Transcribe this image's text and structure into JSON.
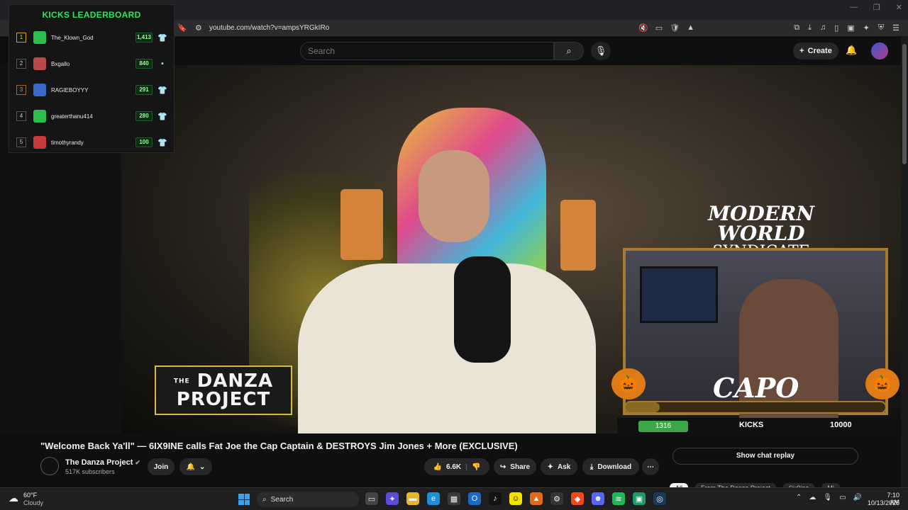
{
  "browser": {
    "url": "youtube.com/watch?v=ampsYRGkIRo"
  },
  "yt_header": {
    "search_placeholder": "Search",
    "create_label": "Create"
  },
  "leaderboard": {
    "title": "KICKS LEADERBOARD",
    "rows": [
      {
        "rank": "1",
        "name": "The_Klown_God",
        "score": "1,413",
        "avatar_color": "#2dbd4e"
      },
      {
        "rank": "2",
        "name": "Bxgallo",
        "score": "840",
        "avatar_color": "#b84a4a"
      },
      {
        "rank": "3",
        "name": "RAGIEBOYYY",
        "score": "291",
        "avatar_color": "#3a6ac9"
      },
      {
        "rank": "4",
        "name": "greaterthanu414",
        "score": "280",
        "avatar_color": "#2dbd4e"
      },
      {
        "rank": "5",
        "name": "timothyrandy",
        "score": "100",
        "avatar_color": "#c93a3a"
      }
    ]
  },
  "overlay": {
    "logo_line1": "DANZA",
    "logo_line2": "PROJECT",
    "logo_prefix": "THE",
    "mws_line1": "MODERN WORLD",
    "mws_line2": "SYNDICATE",
    "capo": "CAPO",
    "kicks_current": "1316",
    "kicks_label": "KICKS",
    "kicks_goal": "10000",
    "progress_fraction": 0.13
  },
  "video": {
    "title": "\"Welcome Back Ya'll\" — 6IX9INE calls Fat Joe the Cap Captain & DESTROYS Jim Jones + More (EXCLUSIVE)",
    "channel": "The Danza Project",
    "subscribers": "517K subscribers",
    "join_label": "Join",
    "likes": "6.6K",
    "share_label": "Share",
    "ask_label": "Ask",
    "download_label": "Download"
  },
  "chat": {
    "replay_label": "Show chat replay"
  },
  "chips": [
    "All",
    "From The Danza Project",
    "6ix9ine",
    "Mi"
  ],
  "taskbar": {
    "temp": "60°F",
    "weather": "Cloudy",
    "search_label": "Search",
    "time": "7:10 AM",
    "date": "10/13/2025"
  }
}
